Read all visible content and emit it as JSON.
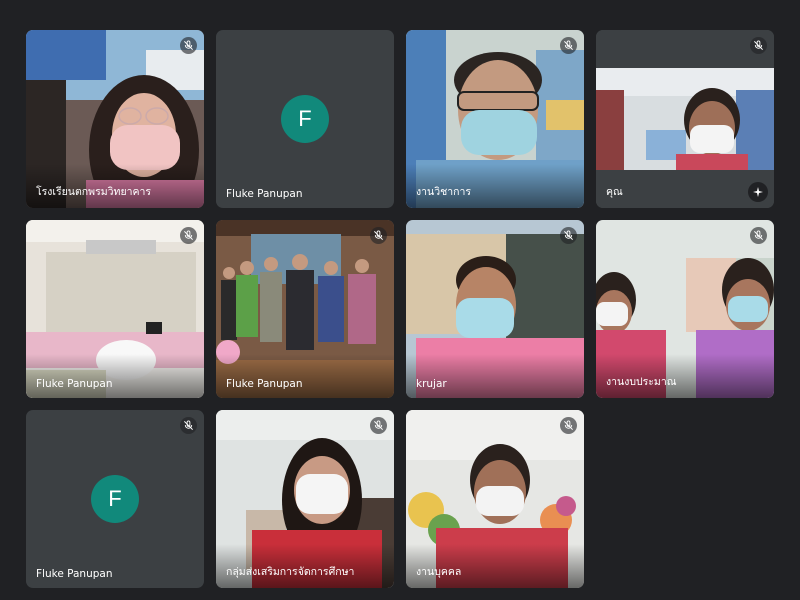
{
  "meeting": {
    "tiles": [
      {
        "name": "โรงเรียนตกพรมวิทยาคาร",
        "muted": true
      },
      {
        "name": "Fluke Panupan",
        "muted": false,
        "avatar_letter": "F"
      },
      {
        "name": "งานวิชาการ",
        "muted": true
      },
      {
        "name": "คุณ",
        "muted": true,
        "has_effects_button": true
      },
      {
        "name": "Fluke Panupan",
        "muted": true
      },
      {
        "name": "Fluke Panupan",
        "muted": true
      },
      {
        "name": "krujar",
        "muted": true
      },
      {
        "name": "งานงบประมาณ",
        "muted": true
      },
      {
        "name": "Fluke Panupan",
        "muted": true,
        "avatar_letter": "F"
      },
      {
        "name": "กลุ่มส่งเสริมการจัดการศึกษา",
        "muted": true
      },
      {
        "name": "งานบุคคล",
        "muted": true
      }
    ]
  },
  "colors": {
    "background": "#202124",
    "idle_tile": "#3c4043",
    "avatar": "#11897b"
  },
  "icons": {
    "mute": "mic-off-icon",
    "effects": "sparkle-icon"
  }
}
